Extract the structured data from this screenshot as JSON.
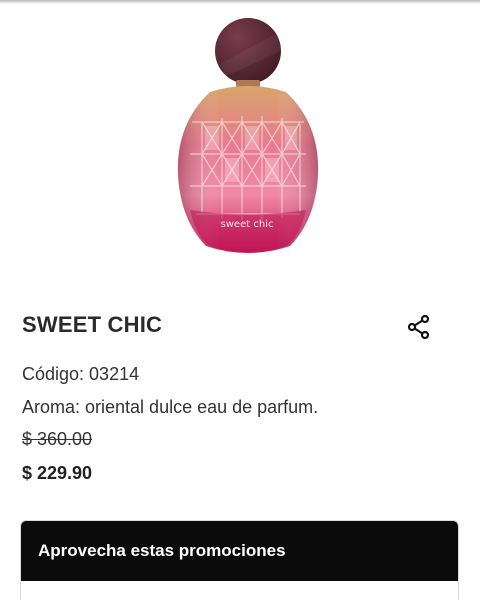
{
  "product": {
    "image_alt": "Sweet Chic perfume bottle",
    "bottle_label": "sweet chic",
    "title": "SWEET CHIC",
    "code_text": "Código: 03214",
    "aroma_text": "Aroma: oriental dulce eau de parfum.",
    "old_price": "$ 360.00",
    "new_price": "$ 229.90"
  },
  "promotions": {
    "header": "Aprovecha estas promociones"
  },
  "icons": {
    "share": "share-icon"
  },
  "colors": {
    "promo_header_bg": "#0b0b0b",
    "bottle_cap": "#5e2a3a",
    "bottle_pink": "#e85a86",
    "bottle_gold": "#d9a56a"
  }
}
